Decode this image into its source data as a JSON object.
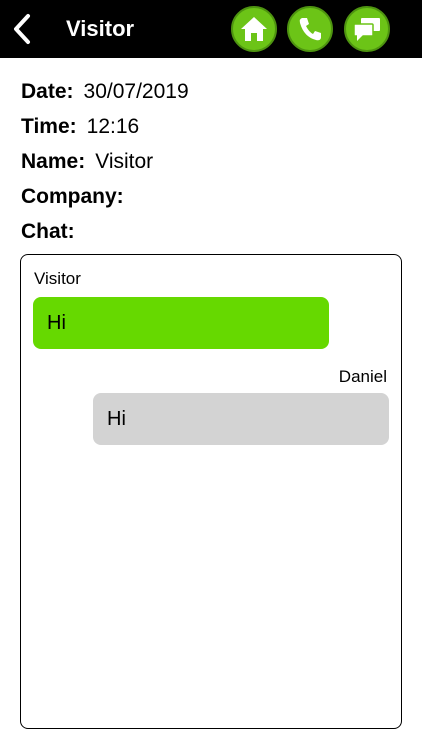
{
  "header": {
    "title": "Visitor",
    "buttons": [
      "home-icon",
      "phone-icon",
      "chat-icon"
    ],
    "accent_color": "#6cc417"
  },
  "info": {
    "date_label": "Date:",
    "date_value": "30/07/2019",
    "time_label": "Time:",
    "time_value": "12:16",
    "name_label": "Name:",
    "name_value": "Visitor",
    "company_label": "Company:",
    "company_value": "",
    "chat_label": "Chat:"
  },
  "chat": {
    "messages": [
      {
        "sender": "Visitor",
        "text": "Hi",
        "color": "#66d900"
      },
      {
        "sender": "Daniel",
        "text": "Hi",
        "color": "#d3d3d3"
      }
    ]
  }
}
